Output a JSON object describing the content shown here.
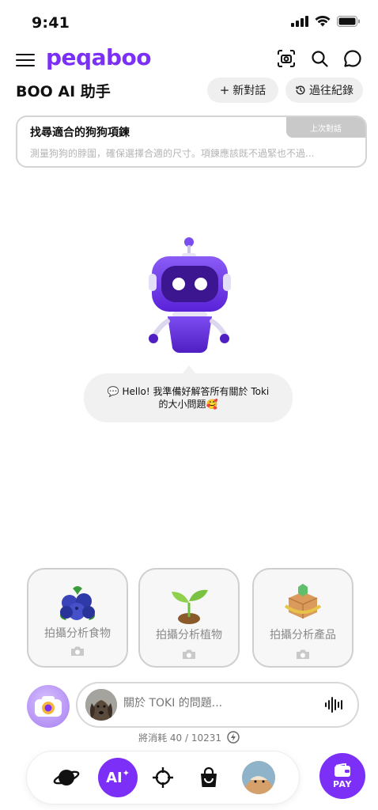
{
  "status_bar": {
    "time": "9:41"
  },
  "app": {
    "logo": "peqaboo"
  },
  "header": {
    "title": "BOO AI 助手",
    "new_chat_label": "新對話",
    "history_label": "過往紀錄"
  },
  "previous_chat": {
    "tag": "上次對話",
    "title": "找尋適合的狗狗項鍊",
    "preview": "測量狗狗的脖圍，確保選擇合適的尺寸。項鍊應該既不過緊也不過..."
  },
  "assistant": {
    "greeting_line1": "Hello! 我準備好解答所有關於 Toki",
    "greeting_line2": "的大小問題"
  },
  "quick_actions": [
    {
      "label": "拍攝分析食物",
      "icon": "blueberry-icon"
    },
    {
      "label": "拍攝分析植物",
      "icon": "sprout-icon"
    },
    {
      "label": "拍攝分析產品",
      "icon": "product-box-icon"
    }
  ],
  "input": {
    "placeholder": "關於 TOKI 的問題..."
  },
  "tokens": {
    "text": "將消耗 40 / 10231"
  },
  "bottom_nav": {
    "ai_label": "AI",
    "pay_label": "PAY"
  },
  "colors": {
    "accent": "#7b2ff7",
    "card_border": "#cfcfcf",
    "muted_text": "#8a8a8a"
  }
}
